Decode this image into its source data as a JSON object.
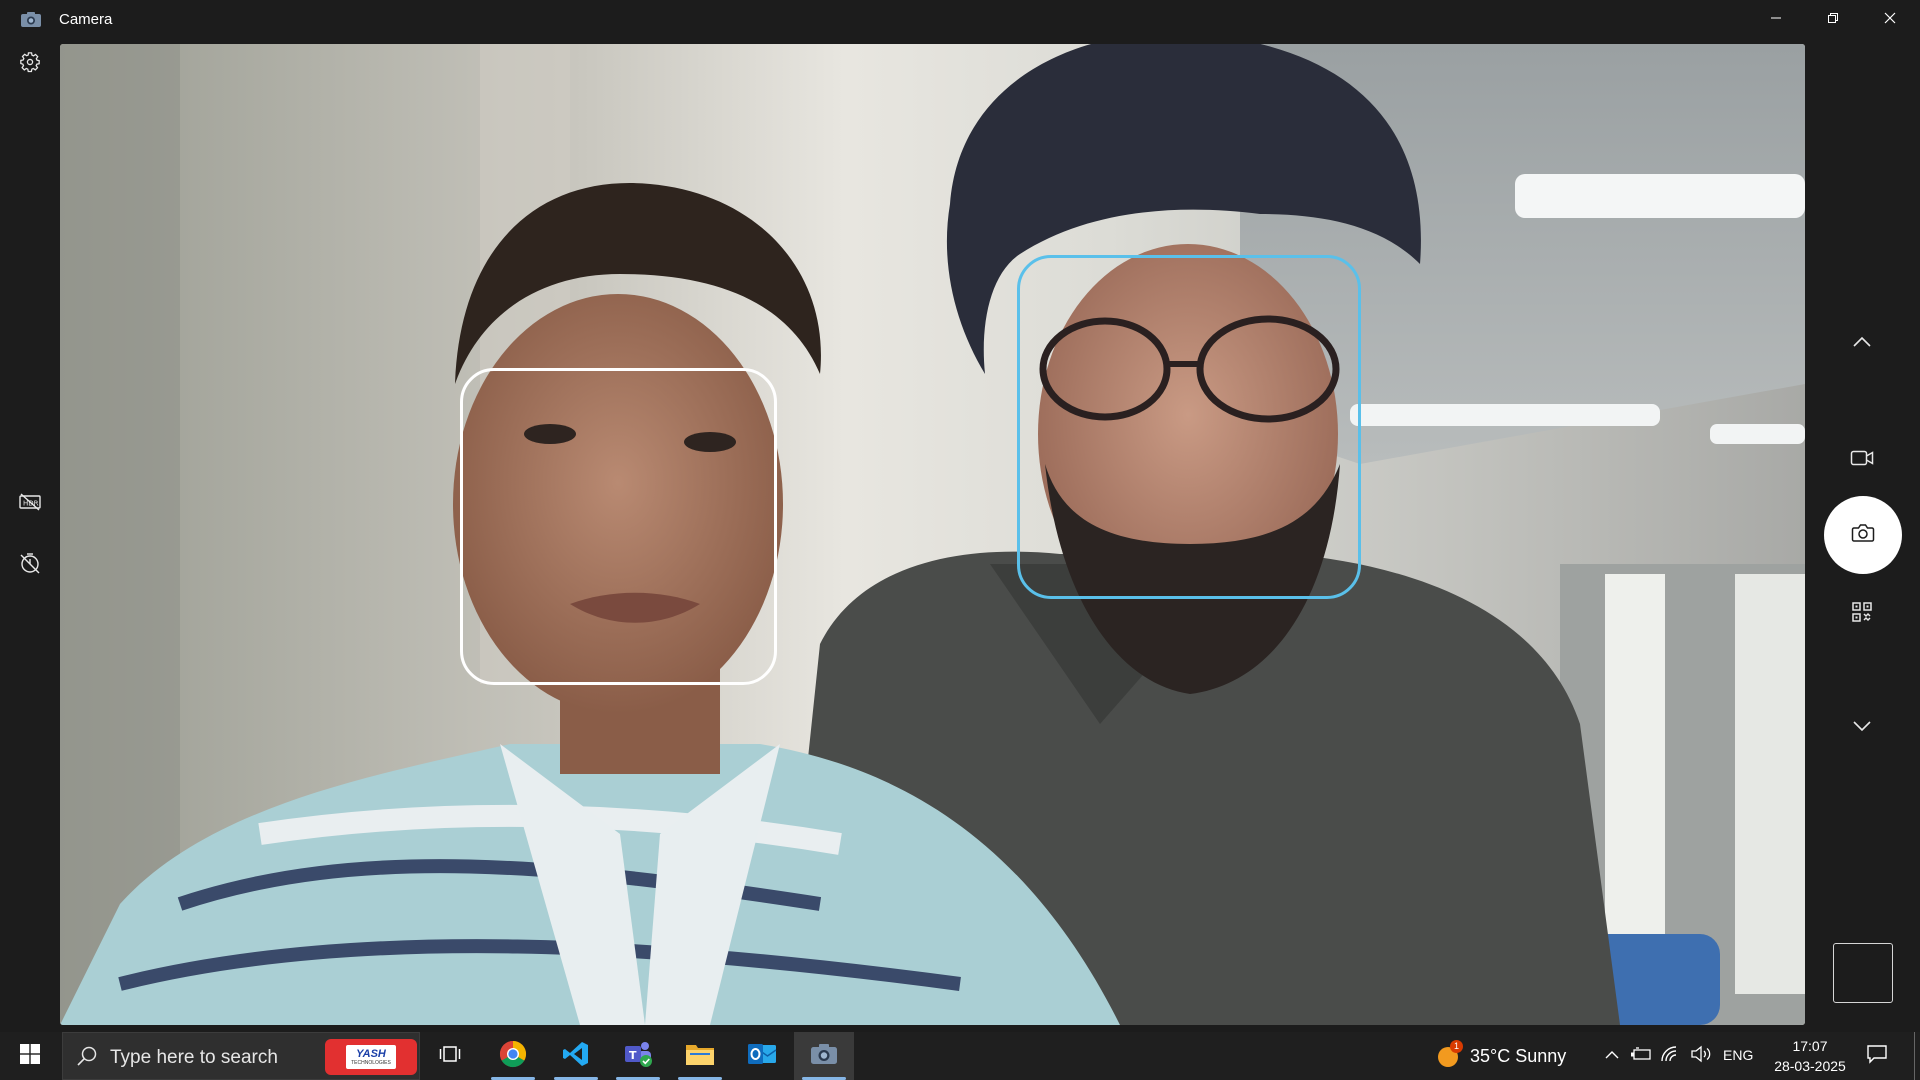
{
  "window": {
    "title": "Camera",
    "app_icon": "camera-app-icon",
    "controls": [
      "minimize-icon",
      "maximize-icon",
      "close-icon"
    ]
  },
  "left_rail": {
    "items": [
      {
        "name": "settings",
        "icon": "gear-icon"
      },
      {
        "name": "hdr-off",
        "icon": "hdr-off-icon"
      },
      {
        "name": "timer-off",
        "icon": "timer-off-icon"
      }
    ]
  },
  "viewfinder": {
    "face_detection_boxes": [
      {
        "name": "face-box-1",
        "color": "#ffffff"
      },
      {
        "name": "face-box-2",
        "color": "#5ac0ea"
      }
    ]
  },
  "right_controls": {
    "items": [
      {
        "name": "mode-up",
        "icon": "chevron-up-icon"
      },
      {
        "name": "video-mode",
        "icon": "video-camera-icon"
      },
      {
        "name": "take-photo",
        "icon": "camera-icon"
      },
      {
        "name": "barcode-mode",
        "icon": "qr-code-icon"
      },
      {
        "name": "mode-down",
        "icon": "chevron-down-icon"
      }
    ]
  },
  "taskbar": {
    "search_placeholder": "Type here to search",
    "search_banner": {
      "word": "YASH",
      "sub": "TECHNOLOGIES"
    },
    "apps": [
      {
        "name": "task-view",
        "icon": "task-view-icon"
      },
      {
        "name": "chrome",
        "icon": "chrome-icon"
      },
      {
        "name": "vscode",
        "icon": "vscode-icon"
      },
      {
        "name": "teams",
        "icon": "teams-icon"
      },
      {
        "name": "file-explorer",
        "icon": "folder-icon"
      },
      {
        "name": "outlook",
        "icon": "outlook-icon"
      },
      {
        "name": "camera",
        "icon": "camera-app-icon"
      }
    ],
    "weather": {
      "text": "35°C  Sunny",
      "badge": "1"
    },
    "tray": {
      "language": "ENG",
      "time": "17:07",
      "date": "28-03-2025"
    }
  }
}
